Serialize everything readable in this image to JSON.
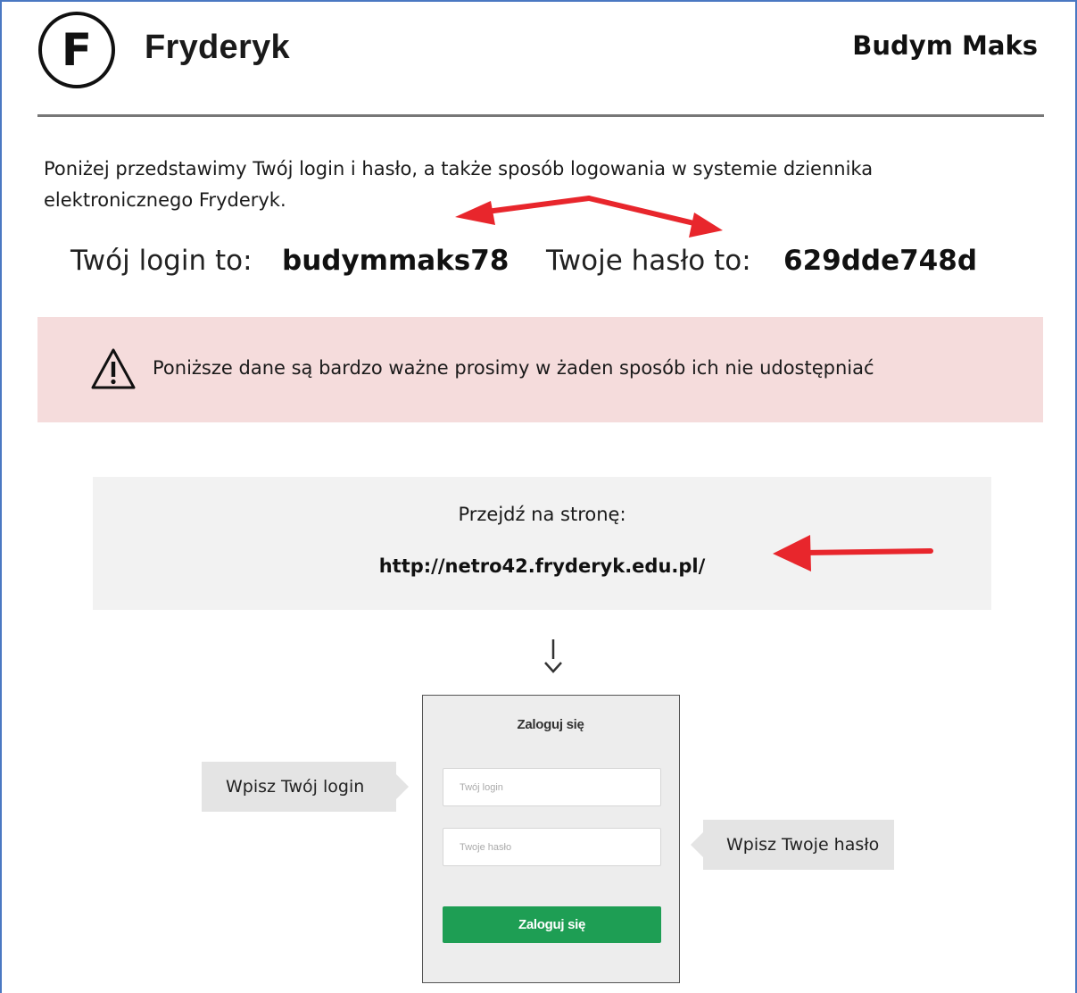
{
  "header": {
    "logo_letter": "F",
    "brand_name": "Fryderyk",
    "user_name": "Budym Maks"
  },
  "intro": {
    "text": "Poniżej przedstawimy Twój login i hasło, a także sposób logowania w systemie dziennika elektronicznego Fryderyk."
  },
  "credentials": {
    "login_label": "Twój login to:",
    "login_value": "budymmaks78",
    "password_label": "Twoje hasło to:",
    "password_value": "629dde748d"
  },
  "warning": {
    "icon": "warning-triangle-icon",
    "text": "Poniższe dane są bardzo ważne prosimy w żaden sposób ich nie udostępniać"
  },
  "goto": {
    "label": "Przejdź na stronę:",
    "url": "http://netro42.fryderyk.edu.pl/"
  },
  "login_form": {
    "title": "Zaloguj się",
    "login_placeholder": "Twój login",
    "password_placeholder": "Twoje hasło",
    "submit_label": "Zaloguj się"
  },
  "callouts": {
    "login_hint": "Wpisz Twój login",
    "password_hint": "Wpisz Twoje hasło"
  },
  "colors": {
    "frame_border": "#4a78c2",
    "warning_bg": "#f5dcdc",
    "goto_bg": "#f2f2f2",
    "annotation_arrow": "#e8262c",
    "submit_button": "#1e9e54"
  }
}
